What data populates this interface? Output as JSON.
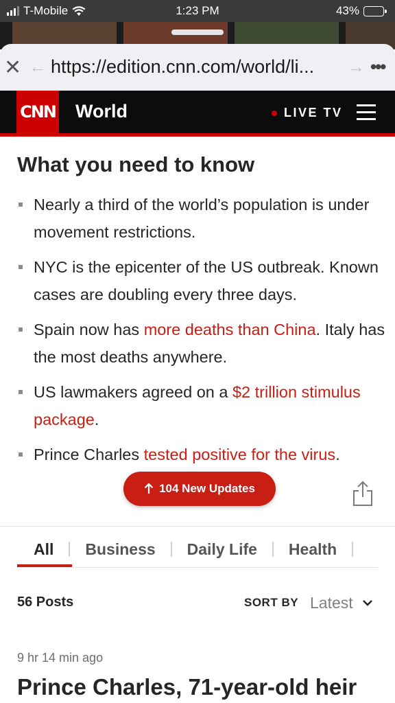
{
  "status_bar": {
    "carrier": "T-Mobile",
    "time": "1:23 PM",
    "battery": "43%",
    "battery_level": 0.43
  },
  "browser": {
    "url": "https://edition.cnn.com/world/li...",
    "more": "•••"
  },
  "header": {
    "logo": "CNN",
    "section": "World",
    "live_tv": "LIVE TV",
    "brand_color": "#cc0000"
  },
  "need_to_know": {
    "title": "What you need to know",
    "items": [
      {
        "text": "Nearly a third of the world’s population is under movement restrictions."
      },
      {
        "text": "NYC is the epicenter of the US outbreak. Known cases are doubling every three days."
      },
      {
        "pre": "Spain now has ",
        "link": "more deaths than China",
        "post": ". Italy has the most deaths anywhere."
      },
      {
        "pre": "US lawmakers agreed on a ",
        "link": "$2 trillion stimulus package",
        "post": "."
      },
      {
        "pre": "Prince Charles ",
        "link": "tested positive for the virus",
        "post": "."
      }
    ]
  },
  "updates_button": {
    "label": "104 New Updates"
  },
  "tabs": [
    {
      "label": "All"
    },
    {
      "label": "Business"
    },
    {
      "label": "Daily Life"
    },
    {
      "label": "Health"
    }
  ],
  "posts": {
    "count_label": "56 Posts",
    "sort_by_label": "SORT BY",
    "sort_value": "Latest"
  },
  "post": {
    "time_ago": "9 hr 14 min ago",
    "headline": "Prince Charles, 71-year-old heir"
  }
}
